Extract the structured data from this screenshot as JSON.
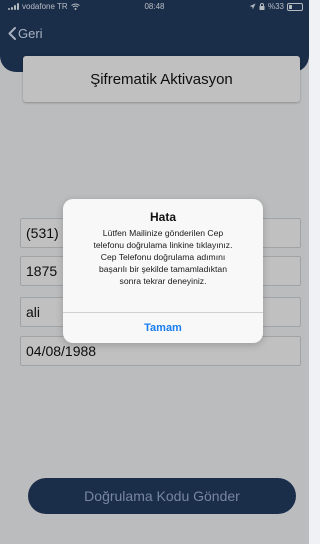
{
  "status_bar": {
    "carrier": "vodafone TR",
    "time": "08:48",
    "battery": "%33"
  },
  "nav": {
    "back_label": "Geri"
  },
  "page": {
    "title": "Şifrematik Aktivasyon"
  },
  "form": {
    "phone": "(531)",
    "id_number": "1875",
    "name": "ali",
    "birth_date": "04/08/1988"
  },
  "submit_button": {
    "label": "Doğrulama Kodu Gönder"
  },
  "alert": {
    "title": "Hata",
    "line1": "Lütfen Mailinize gönderilen Cep",
    "line2": "telefonu doğrulama linkine tıklayınız.",
    "line3": "Cep Telefonu doğrulama adımını",
    "line4": "başarılı bir şekilde tamamladıktan",
    "line5": "sonra tekrar deneyiniz.",
    "button": "Tamam"
  },
  "colors": {
    "header": "#223a5e",
    "background": "#f0f1f4",
    "alert_button": "#1a7cf0"
  },
  "icons": [
    "wifi-icon",
    "chevron-left-icon",
    "battery-icon",
    "location-icon",
    "lock-icon"
  ]
}
